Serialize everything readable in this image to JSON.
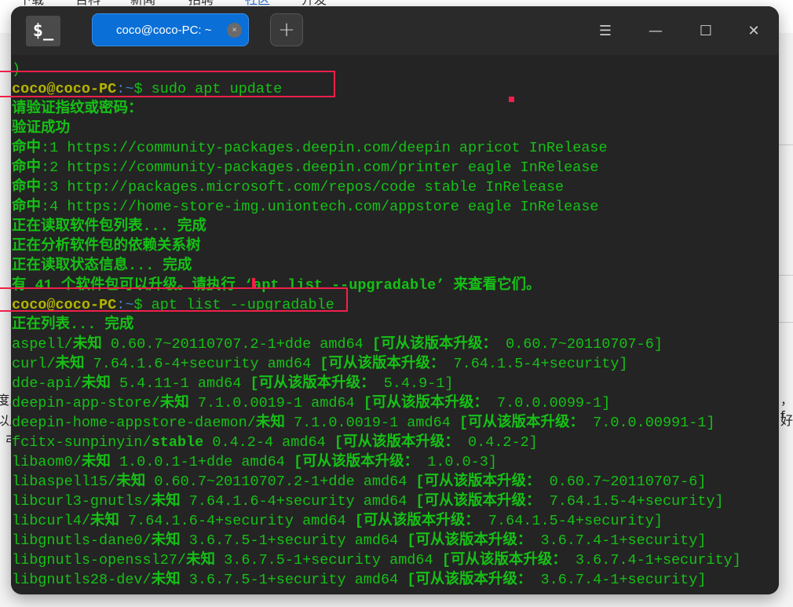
{
  "background_nav": [
    "下载",
    "百科",
    "新闻",
    "招聘",
    "社区",
    "开发"
  ],
  "background_text": [
    "度系",
    "以此",
    "弓",
    "，f",
    "好"
  ],
  "window": {
    "app_icon": "$_",
    "tab_title": "coco@coco-PC: ~",
    "tab_close": "×",
    "new_tab": "+",
    "menu_icon": "☰",
    "minimize_icon": "—",
    "maximize_icon": "☐",
    "close_icon": "✕"
  },
  "terminal": {
    "lines": [
      {
        "type": "text",
        "text": ")"
      },
      {
        "type": "prompt",
        "user": "coco@coco-PC",
        "path": ":~",
        "sym": "$ ",
        "cmd": "sudo apt update"
      },
      {
        "type": "text",
        "text": "请验证指纹或密码：",
        "bold": true
      },
      {
        "type": "text",
        "text": "验证成功",
        "bold": true
      },
      {
        "type": "hit",
        "label": "命中",
        "text": ":1 https://community-packages.deepin.com/deepin apricot InRelease"
      },
      {
        "type": "hit",
        "label": "命中",
        "text": ":2 https://community-packages.deepin.com/printer eagle InRelease"
      },
      {
        "type": "hit",
        "label": "命中",
        "text": ":3 http://packages.microsoft.com/repos/code stable InRelease"
      },
      {
        "type": "hit",
        "label": "命中",
        "text": ":4 https://home-store-img.uniontech.com/appstore eagle InRelease"
      },
      {
        "type": "text",
        "text": "正在读取软件包列表... 完成",
        "bold": true
      },
      {
        "type": "text",
        "text": "正在分析软件包的依赖关系树",
        "bold": true
      },
      {
        "type": "text",
        "text": "正在读取状态信息... 完成",
        "bold": true
      },
      {
        "type": "text",
        "text": "有 41 个软件包可以升级。请执行 ‘apt list --upgradable’ 来查看它们。",
        "bold": true
      },
      {
        "type": "prompt",
        "user": "coco@coco-PC",
        "path": ":~",
        "sym": "$ ",
        "cmd": "apt list --upgradable"
      },
      {
        "type": "text",
        "text": "正在列表... 完成",
        "bold": true
      },
      {
        "type": "pkg",
        "name": "aspell/",
        "status": "未知",
        "rest": " 0.60.7~20110707.2-1+dde amd64 ",
        "upg": "[可从该版本升级：",
        "from": " 0.60.7~20110707-6]"
      },
      {
        "type": "pkg",
        "name": "curl/",
        "status": "未知",
        "rest": " 7.64.1.6-4+security amd64 ",
        "upg": "[可从该版本升级：",
        "from": " 7.64.1.5-4+security]"
      },
      {
        "type": "pkg",
        "name": "dde-api/",
        "status": "未知",
        "rest": " 5.4.11-1 amd64 ",
        "upg": "[可从该版本升级：",
        "from": " 5.4.9-1]"
      },
      {
        "type": "pkg",
        "name": "deepin-app-store/",
        "status": "未知",
        "rest": " 7.1.0.0019-1 amd64 ",
        "upg": "[可从该版本升级：",
        "from": " 7.0.0.0099-1]"
      },
      {
        "type": "pkg",
        "name": "deepin-home-appstore-daemon/",
        "status": "未知",
        "rest": " 7.1.0.0019-1 amd64 ",
        "upg": "[可从该版本升级：",
        "from": " 7.0.0.00991-1]"
      },
      {
        "type": "pkg",
        "name": "fcitx-sunpinyin/",
        "status": "stable",
        "rest": " 0.4.2-4 amd64 ",
        "upg": "[可从该版本升级：",
        "from": " 0.4.2-2]"
      },
      {
        "type": "pkg",
        "name": "libaom0/",
        "status": "未知",
        "rest": " 1.0.0.1-1+dde amd64 ",
        "upg": "[可从该版本升级：",
        "from": " 1.0.0-3]"
      },
      {
        "type": "pkg",
        "name": "libaspell15/",
        "status": "未知",
        "rest": " 0.60.7~20110707.2-1+dde amd64 ",
        "upg": "[可从该版本升级：",
        "from": " 0.60.7~20110707-6]"
      },
      {
        "type": "pkg",
        "name": "libcurl3-gnutls/",
        "status": "未知",
        "rest": " 7.64.1.6-4+security amd64 ",
        "upg": "[可从该版本升级：",
        "from": " 7.64.1.5-4+security]"
      },
      {
        "type": "pkg",
        "name": "libcurl4/",
        "status": "未知",
        "rest": " 7.64.1.6-4+security amd64 ",
        "upg": "[可从该版本升级：",
        "from": " 7.64.1.5-4+security]"
      },
      {
        "type": "pkg",
        "name": "libgnutls-dane0/",
        "status": "未知",
        "rest": " 3.6.7.5-1+security amd64 ",
        "upg": "[可从该版本升级：",
        "from": " 3.6.7.4-1+security]"
      },
      {
        "type": "pkg",
        "name": "libgnutls-openssl27/",
        "status": "未知",
        "rest": " 3.6.7.5-1+security amd64 ",
        "upg": "[可从该版本升级：",
        "from": " 3.6.7.4-1+security]"
      },
      {
        "type": "pkg",
        "name": "libgnutls28-dev/",
        "status": "未知",
        "rest": " 3.6.7.5-1+security amd64 ",
        "upg": "[可从该版本升级：",
        "from": " 3.6.7.4-1+security]"
      }
    ]
  },
  "colors": {
    "text": "#16c016",
    "user": "#b5b500",
    "path": "#3b82c4",
    "highlight": "#f0204a",
    "tab": "#0a6fd6"
  }
}
